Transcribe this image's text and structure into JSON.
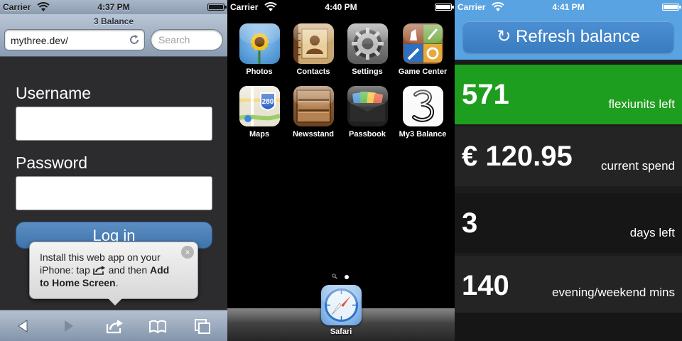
{
  "status_bars": [
    {
      "carrier": "Carrier",
      "time": "4:37 PM"
    },
    {
      "carrier": "Carrier",
      "time": "4:40 PM"
    },
    {
      "carrier": "Carrier",
      "time": "4:41 PM"
    }
  ],
  "safari": {
    "page_title": "3 Balance",
    "url": "mythree.dev/",
    "search_placeholder": "Search",
    "reload_icon": "reload-icon",
    "username_label": "Username",
    "password_label": "Password",
    "login_label": "Log in",
    "tip": {
      "text_before": "Install this web app on your iPhone: tap",
      "text_middle": "and then",
      "bold": "Add to Home Screen",
      "text_after": ".",
      "close": "×"
    },
    "toolbar_icons": [
      "back-icon",
      "forward-icon",
      "share-icon",
      "bookmarks-icon",
      "tabs-icon"
    ]
  },
  "home": {
    "apps": [
      {
        "label": "Photos",
        "icon": "photos-icon"
      },
      {
        "label": "Contacts",
        "icon": "contacts-icon"
      },
      {
        "label": "Settings",
        "icon": "settings-icon"
      },
      {
        "label": "Game Center",
        "icon": "game-center-icon"
      },
      {
        "label": "Maps",
        "icon": "maps-icon"
      },
      {
        "label": "Newsstand",
        "icon": "newsstand-icon"
      },
      {
        "label": "Passbook",
        "icon": "passbook-icon"
      },
      {
        "label": "My3 Balance",
        "icon": "three-icon"
      }
    ],
    "maps_shield": "280",
    "dock_app": {
      "label": "Safari",
      "icon": "safari-icon"
    },
    "pages": {
      "count": 1,
      "current": 1
    }
  },
  "balance": {
    "refresh_label": "↻ Refresh balance",
    "accent": "#5aa3e2",
    "highlight": "#1e9e1e",
    "stats": [
      {
        "value": "571",
        "label": "flexiunits left"
      },
      {
        "value": "€ 120.95",
        "label": "current spend"
      },
      {
        "value": "3",
        "label": "days left"
      },
      {
        "value": "140",
        "label": "evening/weekend mins"
      }
    ]
  }
}
